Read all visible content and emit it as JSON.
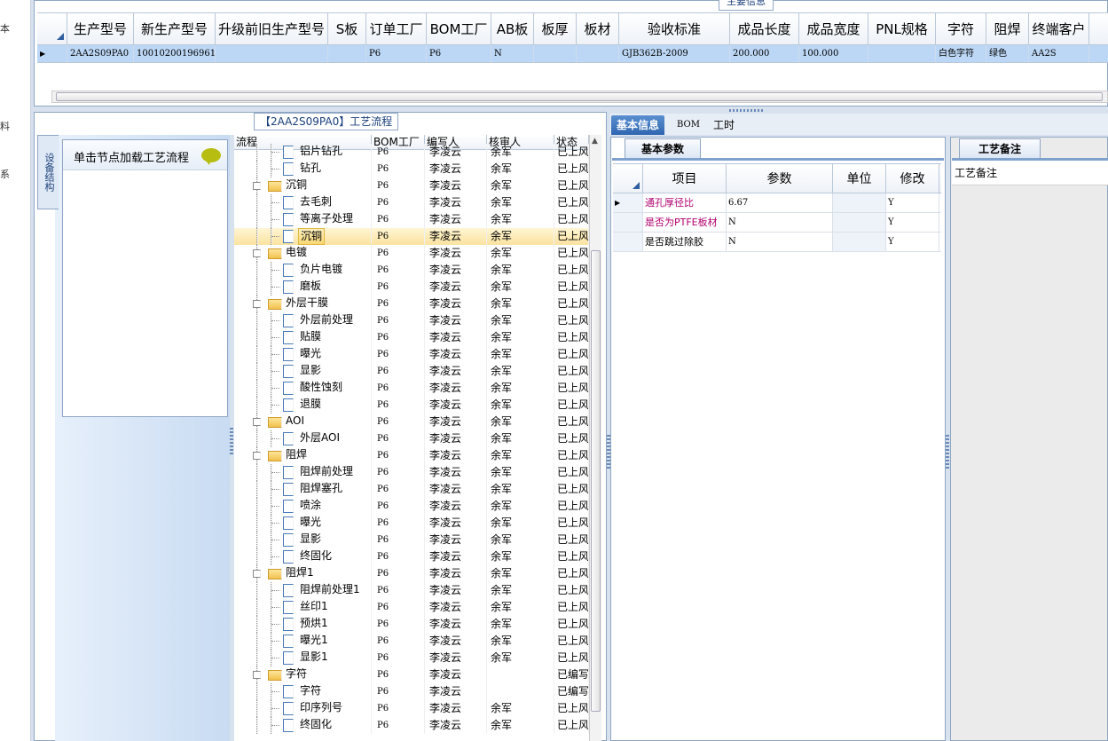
{
  "left_strip": {
    "chars": [
      "本",
      "料",
      "系"
    ]
  },
  "top_panel": {
    "legend": "主要信息",
    "columns": [
      "生产型号",
      "新生产型号",
      "升级前旧生产型号",
      "S板",
      "订单工厂",
      "BOM工厂",
      "AB板",
      "板厚",
      "板材",
      "验收标准",
      "成品长度",
      "成品宽度",
      "PNL规格",
      "字符",
      "阻焊",
      "终端客户"
    ],
    "row": [
      "2AA2S09PA0",
      "10010200196961",
      "",
      "",
      "P6",
      "P6",
      "N",
      "",
      "",
      "GJB362B-2009",
      "200.000",
      "100.000",
      "",
      "白色字符",
      "绿色",
      "AA2S"
    ]
  },
  "process_panel": {
    "title": "【2AA2S09PA0】工艺流程",
    "side_tab": "设备结构",
    "node_hint": "单击节点加载工艺流程",
    "tree_columns": [
      "流程",
      "BOM工厂",
      "编写人",
      "核审人",
      "状态"
    ],
    "rows": [
      {
        "name": "铝片钻孔",
        "level": 2,
        "bom": "P6",
        "writer": "李凌云",
        "reviewer": "余军",
        "status": "已上风"
      },
      {
        "name": "钻孔",
        "level": 2,
        "bom": "P6",
        "writer": "李凌云",
        "reviewer": "余军",
        "status": "已上风"
      },
      {
        "name": "沉铜",
        "level": 1,
        "bom": "P6",
        "writer": "李凌云",
        "reviewer": "余军",
        "status": "已上风"
      },
      {
        "name": "去毛刺",
        "level": 2,
        "bom": "P6",
        "writer": "李凌云",
        "reviewer": "余军",
        "status": "已上风"
      },
      {
        "name": "等离子处理",
        "level": 2,
        "bom": "P6",
        "writer": "李凌云",
        "reviewer": "余军",
        "status": "已上风"
      },
      {
        "name": "沉铜",
        "level": 2,
        "bom": "P6",
        "writer": "李凌云",
        "reviewer": "余军",
        "status": "已上风",
        "selected": true
      },
      {
        "name": "电镀",
        "level": 1,
        "bom": "P6",
        "writer": "李凌云",
        "reviewer": "余军",
        "status": "已上风"
      },
      {
        "name": "负片电镀",
        "level": 2,
        "bom": "P6",
        "writer": "李凌云",
        "reviewer": "余军",
        "status": "已上风"
      },
      {
        "name": "磨板",
        "level": 2,
        "bom": "P6",
        "writer": "李凌云",
        "reviewer": "余军",
        "status": "已上风"
      },
      {
        "name": "外层干膜",
        "level": 1,
        "bom": "P6",
        "writer": "李凌云",
        "reviewer": "余军",
        "status": "已上风"
      },
      {
        "name": "外层前处理",
        "level": 2,
        "bom": "P6",
        "writer": "李凌云",
        "reviewer": "余军",
        "status": "已上风"
      },
      {
        "name": "贴膜",
        "level": 2,
        "bom": "P6",
        "writer": "李凌云",
        "reviewer": "余军",
        "status": "已上风"
      },
      {
        "name": "曝光",
        "level": 2,
        "bom": "P6",
        "writer": "李凌云",
        "reviewer": "余军",
        "status": "已上风"
      },
      {
        "name": "显影",
        "level": 2,
        "bom": "P6",
        "writer": "李凌云",
        "reviewer": "余军",
        "status": "已上风"
      },
      {
        "name": "酸性蚀刻",
        "level": 2,
        "bom": "P6",
        "writer": "李凌云",
        "reviewer": "余军",
        "status": "已上风"
      },
      {
        "name": "退膜",
        "level": 2,
        "bom": "P6",
        "writer": "李凌云",
        "reviewer": "余军",
        "status": "已上风"
      },
      {
        "name": "AOI",
        "level": 1,
        "bom": "P6",
        "writer": "李凌云",
        "reviewer": "余军",
        "status": "已上风"
      },
      {
        "name": "外层AOI",
        "level": 2,
        "bom": "P6",
        "writer": "李凌云",
        "reviewer": "余军",
        "status": "已上风"
      },
      {
        "name": "阻焊",
        "level": 1,
        "bom": "P6",
        "writer": "李凌云",
        "reviewer": "余军",
        "status": "已上风"
      },
      {
        "name": "阻焊前处理",
        "level": 2,
        "bom": "P6",
        "writer": "李凌云",
        "reviewer": "余军",
        "status": "已上风"
      },
      {
        "name": "阻焊塞孔",
        "level": 2,
        "bom": "P6",
        "writer": "李凌云",
        "reviewer": "余军",
        "status": "已上风"
      },
      {
        "name": "喷涂",
        "level": 2,
        "bom": "P6",
        "writer": "李凌云",
        "reviewer": "余军",
        "status": "已上风"
      },
      {
        "name": "曝光",
        "level": 2,
        "bom": "P6",
        "writer": "李凌云",
        "reviewer": "余军",
        "status": "已上风"
      },
      {
        "name": "显影",
        "level": 2,
        "bom": "P6",
        "writer": "李凌云",
        "reviewer": "余军",
        "status": "已上风"
      },
      {
        "name": "终固化",
        "level": 2,
        "bom": "P6",
        "writer": "李凌云",
        "reviewer": "余军",
        "status": "已上风"
      },
      {
        "name": "阻焊1",
        "level": 1,
        "bom": "P6",
        "writer": "李凌云",
        "reviewer": "余军",
        "status": "已上风"
      },
      {
        "name": "阻焊前处理1",
        "level": 2,
        "bom": "P6",
        "writer": "李凌云",
        "reviewer": "余军",
        "status": "已上风"
      },
      {
        "name": "丝印1",
        "level": 2,
        "bom": "P6",
        "writer": "李凌云",
        "reviewer": "余军",
        "status": "已上风"
      },
      {
        "name": "预烘1",
        "level": 2,
        "bom": "P6",
        "writer": "李凌云",
        "reviewer": "余军",
        "status": "已上风"
      },
      {
        "name": "曝光1",
        "level": 2,
        "bom": "P6",
        "writer": "李凌云",
        "reviewer": "余军",
        "status": "已上风"
      },
      {
        "name": "显影1",
        "level": 2,
        "bom": "P6",
        "writer": "李凌云",
        "reviewer": "余军",
        "status": "已上风"
      },
      {
        "name": "字符",
        "level": 1,
        "bom": "P6",
        "writer": "李凌云",
        "reviewer": "",
        "status": "已编写"
      },
      {
        "name": "字符",
        "level": 2,
        "bom": "P6",
        "writer": "李凌云",
        "reviewer": "",
        "status": "已编写"
      },
      {
        "name": "印序列号",
        "level": 2,
        "bom": "P6",
        "writer": "李凌云",
        "reviewer": "余军",
        "status": "已上风"
      },
      {
        "name": "终固化",
        "level": 2,
        "bom": "P6",
        "writer": "李凌云",
        "reviewer": "余军",
        "status": "已上风"
      }
    ],
    "first_cut_label": "钻孔"
  },
  "info_tabs": [
    "基本信息",
    "BOM",
    "工时"
  ],
  "params": {
    "tab": "基本参数",
    "columns": [
      "项目",
      "参数",
      "单位",
      "修改"
    ],
    "rows": [
      {
        "item": "通孔厚径比",
        "value": "6.67",
        "unit": "",
        "modify": "Y",
        "highlight": true
      },
      {
        "item": "是否为PTFE板材",
        "value": "N",
        "unit": "",
        "modify": "Y",
        "highlight": true
      },
      {
        "item": "是否跳过除胶",
        "value": "N",
        "unit": "",
        "modify": "Y",
        "highlight": false
      }
    ]
  },
  "notes": {
    "tab": "工艺备注",
    "label": "工艺备注"
  },
  "colors": {
    "accent": "#2f66b0",
    "selected_row": "#bcd7f5",
    "highlight_text": "#b0006e"
  }
}
